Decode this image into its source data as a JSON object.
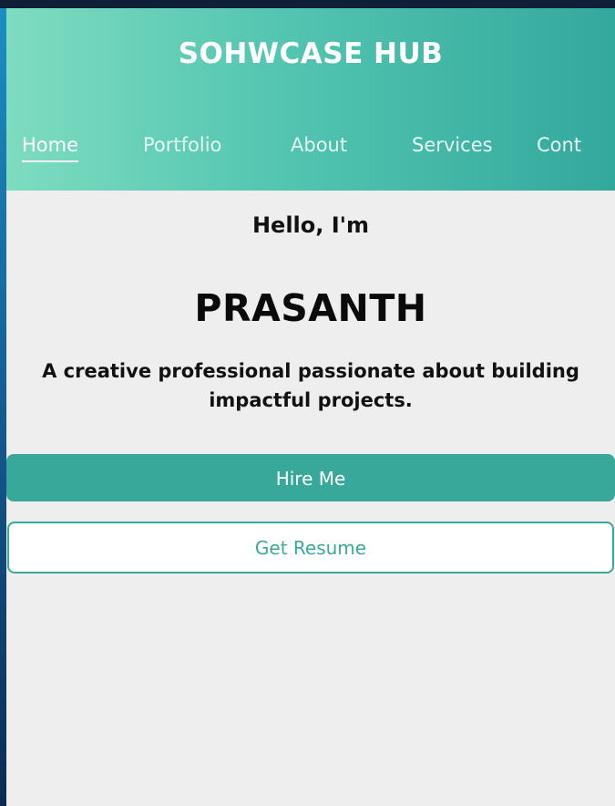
{
  "header": {
    "brand": "SOHWCASE HUB"
  },
  "nav": {
    "items": [
      {
        "label": "Home",
        "active": true
      },
      {
        "label": "Portfolio",
        "active": false
      },
      {
        "label": "About",
        "active": false
      },
      {
        "label": "Services",
        "active": false
      },
      {
        "label": "Cont",
        "active": false
      }
    ]
  },
  "hero": {
    "greeting": "Hello, I'm",
    "name": "PRASANTH",
    "tagline_line1": "A creative professional passionate about building",
    "tagline_line2": "impactful projects."
  },
  "actions": {
    "hire_label": "Hire Me",
    "resume_label": "Get Resume"
  },
  "colors": {
    "header_start": "#7edcc0",
    "header_end": "#33a89c",
    "accent": "#38a89b",
    "page_background": "#eeeeee"
  }
}
